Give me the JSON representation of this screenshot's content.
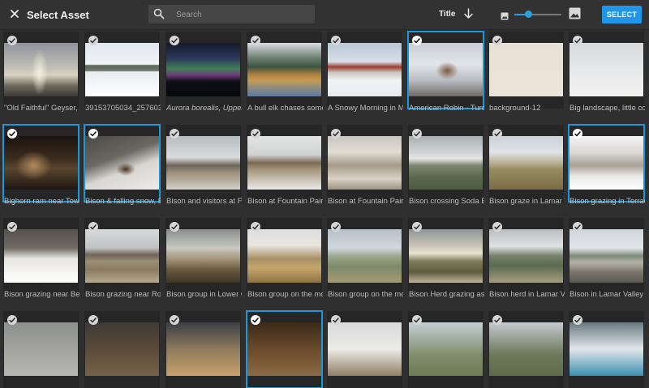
{
  "header": {
    "title": "Select Asset",
    "search_placeholder": "Search",
    "sort_label": "Title",
    "select_label": "SELECT",
    "thumbnail_size_fraction": 0.3
  },
  "colors": {
    "accent": "#2196e8",
    "selection_outline": "#1e97d8",
    "background": "#2f2f2f"
  },
  "assets": [
    {
      "caption": "\"Old Faithful\" Geyser, Y",
      "selected": false,
      "italic": false
    },
    {
      "caption": "39153705034_257603",
      "selected": false,
      "italic": false
    },
    {
      "caption": "Aurora borealis, Upper",
      "selected": false,
      "italic": true
    },
    {
      "caption": "A bull elk chases some",
      "selected": false,
      "italic": false
    },
    {
      "caption": "A Snowy Morning in M",
      "selected": false,
      "italic": false
    },
    {
      "caption": "American Robin - Turd",
      "selected": true,
      "italic": false
    },
    {
      "caption": "background-12",
      "selected": false,
      "italic": false
    },
    {
      "caption": "Big landscape, little co",
      "selected": false,
      "italic": false
    },
    {
      "caption": "Bighorn ram near Tow",
      "selected": true,
      "italic": false
    },
    {
      "caption": "Bison & falling snow, E",
      "selected": true,
      "italic": false
    },
    {
      "caption": "Bison and visitors at F",
      "selected": false,
      "italic": false
    },
    {
      "caption": "Bison at Fountain Pair",
      "selected": false,
      "italic": false
    },
    {
      "caption": "Bison at Fountain Pair",
      "selected": false,
      "italic": false
    },
    {
      "caption": "Bison crossing Soda B",
      "selected": false,
      "italic": false
    },
    {
      "caption": "Bison graze in Lamar V",
      "selected": false,
      "italic": false
    },
    {
      "caption": "Bison grazing in Terrac",
      "selected": true,
      "italic": false
    },
    {
      "caption": "Bison grazing near Bea",
      "selected": false,
      "italic": false
    },
    {
      "caption": "Bison grazing near Ro",
      "selected": false,
      "italic": false
    },
    {
      "caption": "Bison group in Lower G",
      "selected": false,
      "italic": false
    },
    {
      "caption": "Bison group on the mo",
      "selected": false,
      "italic": false
    },
    {
      "caption": "Bison group on the mo",
      "selected": false,
      "italic": false
    },
    {
      "caption": "Bison Herd grazing as",
      "selected": false,
      "italic": false
    },
    {
      "caption": "Bison herd in Lamar V",
      "selected": false,
      "italic": false
    },
    {
      "caption": "Bison in Lamar Valley",
      "selected": false,
      "italic": false
    },
    {
      "caption": "",
      "selected": false,
      "italic": false
    },
    {
      "caption": "",
      "selected": false,
      "italic": false
    },
    {
      "caption": "",
      "selected": false,
      "italic": false
    },
    {
      "caption": "",
      "selected": true,
      "italic": false
    },
    {
      "caption": "",
      "selected": false,
      "italic": false
    },
    {
      "caption": "",
      "selected": false,
      "italic": false
    },
    {
      "caption": "",
      "selected": false,
      "italic": false
    },
    {
      "caption": "",
      "selected": false,
      "italic": false
    }
  ]
}
